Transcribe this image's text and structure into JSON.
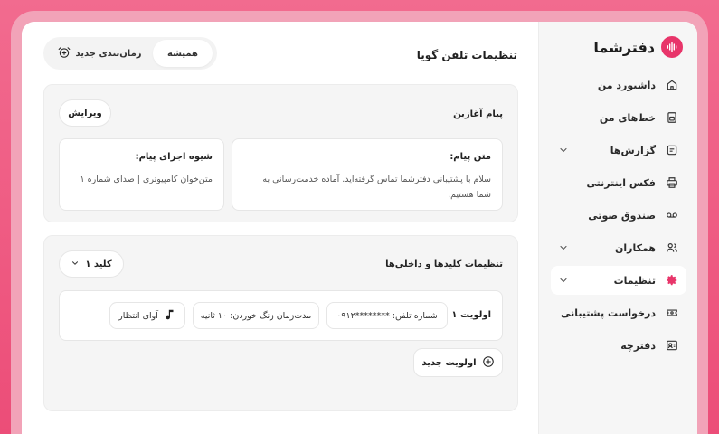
{
  "brand": {
    "name": "دفترشما",
    "logo_icon": "soundwave-icon",
    "accent": "#e8356a"
  },
  "sidebar": {
    "items": [
      {
        "label": "داشبورد من",
        "icon": "home-icon",
        "expandable": false,
        "active": false
      },
      {
        "label": "خط‌های من",
        "icon": "sim-card-icon",
        "expandable": false,
        "active": false
      },
      {
        "label": "گزارش‌ها",
        "icon": "report-icon",
        "expandable": true,
        "active": false
      },
      {
        "label": "فکس اینترنتی",
        "icon": "printer-icon",
        "expandable": false,
        "active": false
      },
      {
        "label": "صندوق صوتی",
        "icon": "voicemail-icon",
        "expandable": false,
        "active": false
      },
      {
        "label": "همکاران",
        "icon": "users-icon",
        "expandable": true,
        "active": false
      },
      {
        "label": "تنظیمات",
        "icon": "gear-icon",
        "expandable": true,
        "active": true
      },
      {
        "label": "درخواست پشتیبانی",
        "icon": "ticket-icon",
        "expandable": false,
        "active": false
      },
      {
        "label": "دفترچه",
        "icon": "contact-card-icon",
        "expandable": false,
        "active": false
      }
    ]
  },
  "header": {
    "title": "تنظیمات تلفن گویا",
    "schedule_button": "زمان‌بندی جدید",
    "always_button": "همیشه"
  },
  "welcome": {
    "title": "پیام آغازین",
    "edit_button": "ویرایش",
    "message_label": "متن پیام:",
    "message_text_line1": "سلام با پشتیبانی دفترشما تماس گرفته‌اید. آماده خدمت‌رسانی به",
    "message_text_line2": "شما هستیم.",
    "method_label": "شیوه اجرای پیام:",
    "method_text": "متن‌خوان کامپیوتری | صدای شماره ۱"
  },
  "keys": {
    "title": "تنظیمات کلیدها و داخلی‌ها",
    "key_select": "کلید ۱",
    "priority_label": "اولویت ۱",
    "phone_chip": "شماره تلفن: ********۰۹۱۲",
    "ring_chip": "مدت‌زمان زنگ خوردن: ۱۰ ثانیه",
    "music_chip": "آوای انتظار",
    "add_priority_button": "اولویت جدید"
  }
}
